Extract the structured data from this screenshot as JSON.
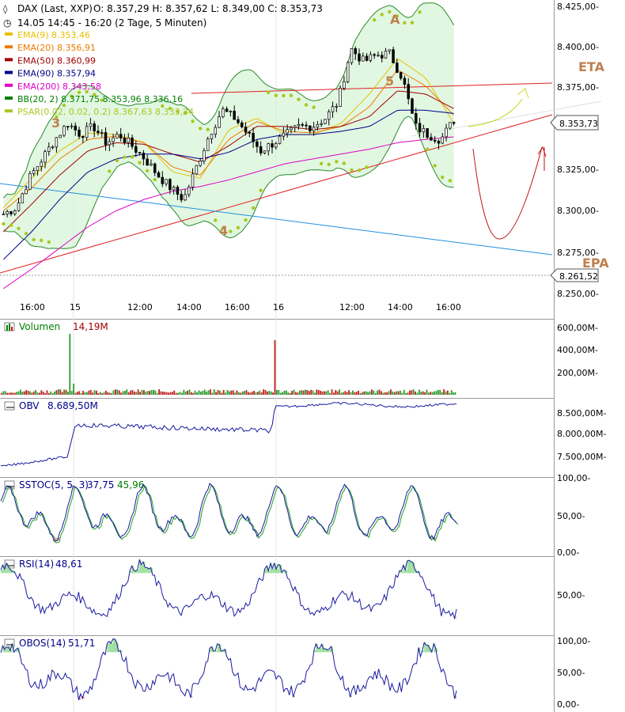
{
  "header": {
    "title": "DAX (Last, XXP)",
    "ohlc": "O: 8.357,29  H: 8.357,62  L: 8.349,00  C: 8.353,73",
    "range": "14.05 14:45 - 16:20 (2 Tage, 5 Minuten)"
  },
  "legend": [
    {
      "name": "EMA(9)",
      "value": "8.353,46",
      "color": "#e6c200"
    },
    {
      "name": "EMA(20)",
      "value": "8.356,91",
      "color": "#f07a00"
    },
    {
      "name": "EMA(50)",
      "value": "8.360,99",
      "color": "#a00000"
    },
    {
      "name": "EMA(90)",
      "value": "8.357,94",
      "color": "#00008b"
    },
    {
      "name": "EMA(200)",
      "value": "8.343,58",
      "color": "#e000c8"
    },
    {
      "name": "BB(20, 2)",
      "value": "8.371,75   8.353,96   8.336,16",
      "color": "#008000"
    },
    {
      "name": "PSAR(0.02, 0.02, 0.2)",
      "value": "8.367,63   8.333,34",
      "color": "#a8c820"
    }
  ],
  "annotations": {
    "wave_a": "A",
    "wave_3": "3",
    "wave_4": "4",
    "wave_5": "5",
    "eta": "ETA",
    "epa": "EPA",
    "current_price": "8.353,73",
    "epa_price": "8.261,52"
  },
  "price_axis": {
    "ticks": [
      "8.425,00-",
      "8.400,00-",
      "8.375,00-",
      "8.325,00-",
      "8.300,00-",
      "8.275,00-",
      "8.250,00-"
    ]
  },
  "time_axis": {
    "labels": [
      "16:00",
      "15",
      "12:00",
      "14:00",
      "16:00",
      "16",
      "12:00",
      "14:00",
      "16:00"
    ]
  },
  "panels": {
    "volume": {
      "name": "Volumen",
      "value": "14,19M",
      "ticks": [
        "600,00M-",
        "400,00M-",
        "200,00M-"
      ]
    },
    "obv": {
      "name": "OBV",
      "value": "8.689,50M",
      "ticks": [
        "8.500,00M-",
        "8.000,00M-",
        "7.500,00M-"
      ]
    },
    "sstoc": {
      "name": "SSTOC(5, 5, 3)",
      "value": "37,75",
      "value2": "45,96",
      "ticks": [
        "100,00-",
        "50,00-",
        "0,00-"
      ]
    },
    "rsi": {
      "name": "RSI(14)",
      "value": "48,61",
      "ticks": [
        "50,00-"
      ]
    },
    "obos": {
      "name": "OBOS(14)",
      "value": "51,71",
      "ticks": [
        "100,00-",
        "50,00-",
        "0,00-"
      ]
    }
  },
  "chart_data": {
    "type": "candlestick",
    "interval": "5 Minuten",
    "ylim": [
      8245,
      8428
    ],
    "x": [
      "16:00",
      "15",
      "12:00",
      "14:00",
      "16:00",
      "16",
      "12:00",
      "14:00",
      "16:00"
    ],
    "close_path": [
      8296,
      8300,
      8318,
      8330,
      8342,
      8352,
      8345,
      8350,
      8340,
      8345,
      8338,
      8330,
      8320,
      8312,
      8305,
      8325,
      8345,
      8360,
      8355,
      8345,
      8335,
      8340,
      8345,
      8350,
      8350,
      8355,
      8365,
      8398,
      8390,
      8394,
      8395,
      8380,
      8350,
      8345,
      8342,
      8354
    ],
    "last": 8353.73,
    "series": [
      {
        "name": "EMA(9)",
        "values": [
          8300,
          8318,
          8335,
          8346,
          8345,
          8340,
          8322,
          8318,
          8348,
          8355,
          8345,
          8345,
          8352,
          8370,
          8392,
          8380,
          8352
        ]
      },
      {
        "name": "EMA(20)",
        "values": [
          8298,
          8312,
          8330,
          8342,
          8344,
          8340,
          8325,
          8320,
          8342,
          8353,
          8347,
          8346,
          8350,
          8362,
          8385,
          8375,
          8357
        ]
      },
      {
        "name": "EMA(50)",
        "values": [
          8285,
          8302,
          8320,
          8335,
          8340,
          8339,
          8333,
          8328,
          8338,
          8350,
          8350,
          8348,
          8350,
          8356,
          8372,
          8370,
          8361
        ]
      },
      {
        "name": "EMA(90)",
        "values": [
          8268,
          8285,
          8305,
          8322,
          8330,
          8333,
          8333,
          8330,
          8334,
          8342,
          8345,
          8345,
          8347,
          8350,
          8360,
          8360,
          8358
        ]
      },
      {
        "name": "EMA(200)",
        "values": [
          8250,
          8262,
          8275,
          8288,
          8298,
          8305,
          8310,
          8313,
          8317,
          8322,
          8327,
          8330,
          8333,
          8336,
          8340,
          8342,
          8343.58
        ]
      }
    ],
    "trendlines": [
      {
        "from": [
          "start",
          8257
        ],
        "to": [
          "end",
          8368
        ]
      },
      {
        "from": [
          "start",
          8317
        ],
        "to": [
          "end",
          8274
        ]
      },
      {
        "from": [
          "start",
          8378
        ],
        "to": [
          "end",
          8377
        ]
      }
    ],
    "volume_spikes": [
      {
        "at": "15 open",
        "value": 590
      },
      {
        "at": "16 open",
        "value": 520
      }
    ]
  }
}
